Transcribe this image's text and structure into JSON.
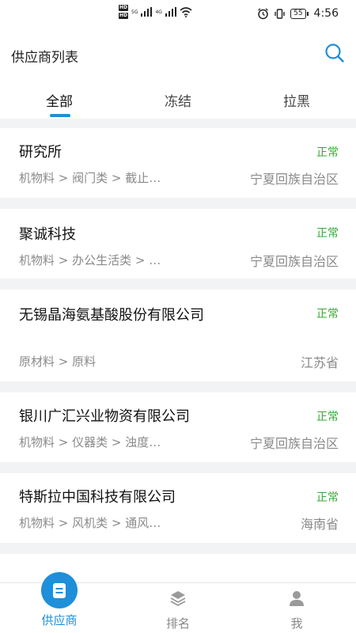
{
  "status_bar": {
    "hd1": "HD",
    "hd2": "HD",
    "network_5g": "5G",
    "network_4g": "4G",
    "battery": "55",
    "time": "4:56"
  },
  "header": {
    "title": "供应商列表"
  },
  "tabs": [
    {
      "label": "全部",
      "active": true
    },
    {
      "label": "冻结",
      "active": false
    },
    {
      "label": "拉黑",
      "active": false
    }
  ],
  "suppliers": [
    {
      "name": "研究所",
      "status": "正常",
      "category": "机物料 > 阀门类 > 截止…",
      "region": "宁夏回族自治区"
    },
    {
      "name": "聚诚科技",
      "status": "正常",
      "category": "机物料 > 办公生活类 > …",
      "region": "宁夏回族自治区"
    },
    {
      "name": "无锡晶海氨基酸股份有限公司",
      "status": "正常",
      "category": "原材料 > 原料",
      "region": "江苏省"
    },
    {
      "name": "银川广汇兴业物资有限公司",
      "status": "正常",
      "category": "机物料 > 仪器类 > 浊度…",
      "region": "宁夏回族自治区"
    },
    {
      "name": "特斯拉中国科技有限公司",
      "status": "正常",
      "category": "机物料 > 风机类 > 通风…",
      "region": "海南省"
    }
  ],
  "bottom_nav": [
    {
      "label": "供应商",
      "icon": "document-icon",
      "active": true
    },
    {
      "label": "排名",
      "icon": "layers-icon",
      "active": false
    },
    {
      "label": "我",
      "icon": "person-icon",
      "active": false
    }
  ],
  "colors": {
    "accent": "#1e8fd8",
    "status_ok": "#35a935"
  }
}
